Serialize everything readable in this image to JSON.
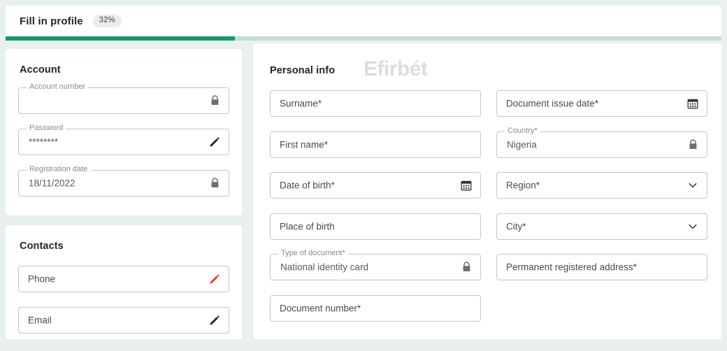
{
  "header": {
    "tab_label": "Fill in profile",
    "progress_badge": "32%",
    "progress_percent": 32,
    "accent_color": "#17996a",
    "track_color": "#c8dcd5"
  },
  "watermark": {
    "text": "Efirbét",
    "color": "#dcdcdc"
  },
  "account": {
    "title": "Account",
    "fields": [
      {
        "legend": "Account number",
        "value": "",
        "icon": "lock-icon",
        "style": "outlined"
      },
      {
        "legend": "Password",
        "value": "********",
        "icon": "pencil-icon",
        "style": "outlined"
      },
      {
        "legend": "Registration date",
        "value": "18/11/2022",
        "icon": "lock-icon",
        "style": "outlined"
      }
    ]
  },
  "contacts": {
    "title": "Contacts",
    "fields": [
      {
        "placeholder": "Phone",
        "icon": "pencil-icon",
        "icon_color": "#f0353b",
        "style": "plain"
      },
      {
        "placeholder": "Email",
        "icon": "pencil-icon",
        "icon_color": "#222222",
        "style": "plain"
      }
    ]
  },
  "personal": {
    "title": "Personal info",
    "column_left": [
      {
        "placeholder": "Surname*",
        "icon": "",
        "style": "plain"
      },
      {
        "placeholder": "First name*",
        "icon": "",
        "style": "plain"
      },
      {
        "placeholder": "Date of birth*",
        "icon": "calendar-icon",
        "style": "plain"
      },
      {
        "placeholder": "Place of birth",
        "icon": "",
        "style": "plain"
      },
      {
        "legend": "Type of document*",
        "value": "National identity card",
        "icon": "lock-icon",
        "style": "outlined"
      },
      {
        "placeholder": "Document number*",
        "icon": "",
        "style": "plain"
      }
    ],
    "column_right": [
      {
        "placeholder": "Document issue date*",
        "icon": "calendar-icon",
        "style": "plain"
      },
      {
        "legend": "Country*",
        "value": "Nigeria",
        "icon": "lock-icon",
        "style": "outlined"
      },
      {
        "placeholder": "Region*",
        "icon": "chevron-down-icon",
        "style": "plain"
      },
      {
        "placeholder": "City*",
        "icon": "chevron-down-icon",
        "style": "plain"
      },
      {
        "placeholder": "Permanent registered address*",
        "icon": "",
        "style": "plain"
      }
    ]
  }
}
